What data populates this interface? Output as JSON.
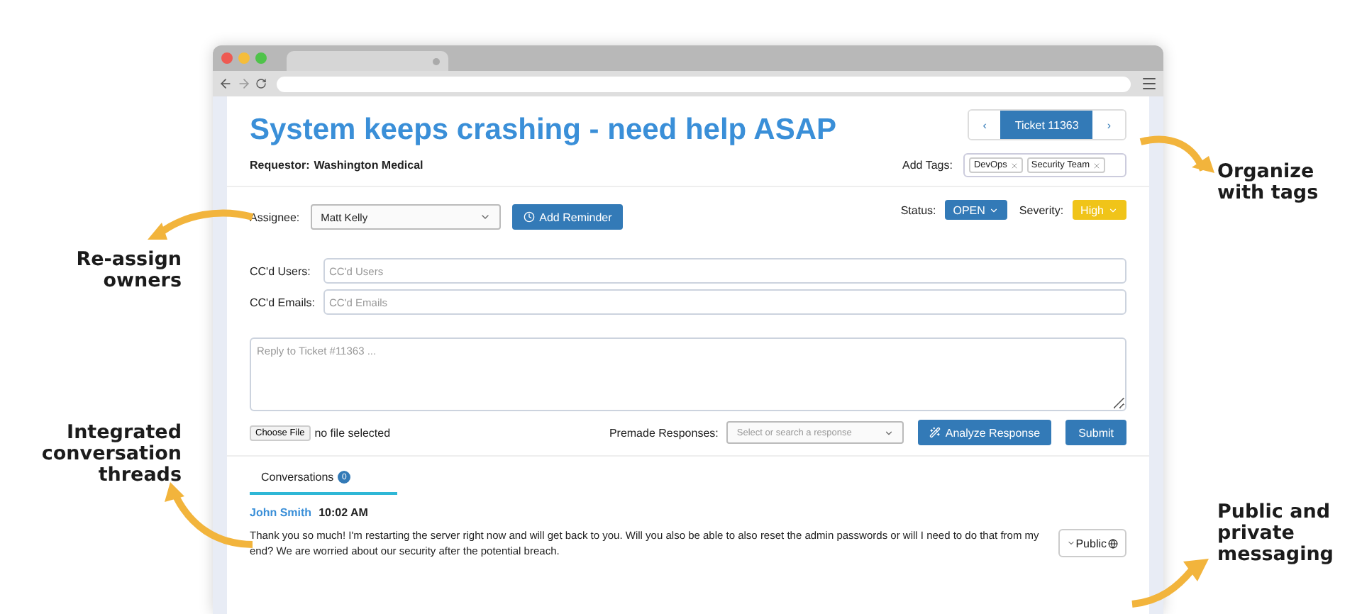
{
  "ticket": {
    "title": "System keeps crashing - need help ASAP",
    "requestor_label": "Requestor:",
    "requestor": "Washington Medical",
    "nav": {
      "prev": "‹",
      "current": "Ticket 11363",
      "next": "›"
    },
    "tags_label": "Add Tags:",
    "tags": [
      {
        "label": "DevOps"
      },
      {
        "label": "Security Team"
      }
    ]
  },
  "assignee": {
    "label": "Assignee:",
    "value": "Matt Kelly"
  },
  "reminder_button": "Add Reminder",
  "badges": [
    {
      "label": "Status:",
      "value": "OPEN",
      "color": "#337ab7"
    },
    {
      "label": "Severity:",
      "value": "High",
      "color": "#f0c419"
    }
  ],
  "cc_fields": [
    {
      "label": "CC'd Users:",
      "placeholder": "CC'd Users"
    },
    {
      "label": "CC'd Emails:",
      "placeholder": "CC'd Emails"
    }
  ],
  "reply": {
    "placeholder": "Reply to Ticket #11363 ..."
  },
  "file": {
    "button": "Choose File",
    "status": "no file selected"
  },
  "premade": {
    "label": "Premade Responses:",
    "placeholder": "Select or search a response"
  },
  "analyze_button": "Analyze Response",
  "submit_button": "Submit",
  "tabs": [
    {
      "label": "Conversations",
      "badge": "0",
      "selected": true
    }
  ],
  "messages": [
    {
      "author": "John Smith",
      "time": "10:02 AM",
      "text": "Thank you so much! I'm restarting the server right now and will get back to you. Will you also be able to also reset the admin passwords or will I need to do that from my end? We are worried about our security after the potential breach.",
      "visibility": "Public"
    }
  ],
  "left_callouts": [
    "Re-assign owners",
    "Integrated conversation threads"
  ],
  "right_callouts": [
    "Organize with tags",
    "Public and private messaging"
  ]
}
